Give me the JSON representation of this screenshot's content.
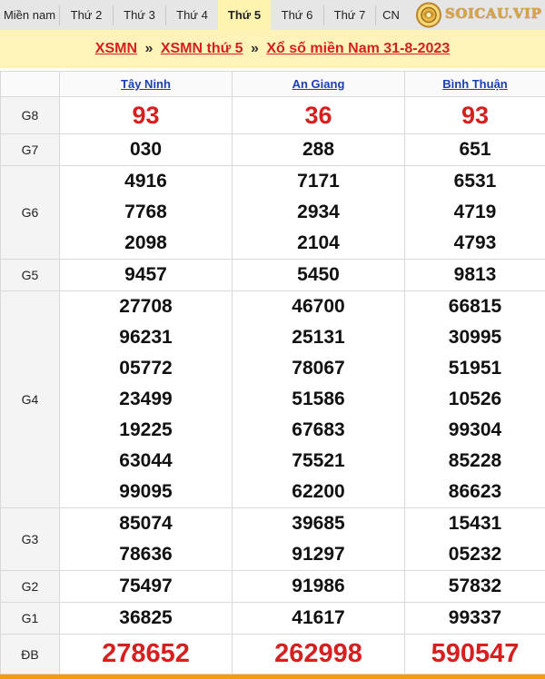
{
  "nav": {
    "tabs": [
      {
        "label": "Miền nam",
        "active": false
      },
      {
        "label": "Thứ 2",
        "active": false
      },
      {
        "label": "Thứ 3",
        "active": false
      },
      {
        "label": "Thứ 4",
        "active": false
      },
      {
        "label": "Thứ 5",
        "active": true
      },
      {
        "label": "Thứ 6",
        "active": false
      },
      {
        "label": "Thứ 7",
        "active": false
      },
      {
        "label": "CN",
        "active": false
      }
    ],
    "logo_text": "SOICAU.VIP"
  },
  "breadcrumb": {
    "items": [
      "XSMN",
      "XSMN thứ 5",
      "Xổ số miền Nam 31-8-2023"
    ],
    "separator": "»"
  },
  "table": {
    "provinces": [
      "Tây Ninh",
      "An Giang",
      "Bình Thuận"
    ],
    "rows": [
      {
        "label": "G8",
        "values": [
          [
            "93"
          ],
          [
            "36"
          ],
          [
            "93"
          ]
        ]
      },
      {
        "label": "G7",
        "values": [
          [
            "030"
          ],
          [
            "288"
          ],
          [
            "651"
          ]
        ]
      },
      {
        "label": "G6",
        "values": [
          [
            "4916",
            "7768",
            "2098"
          ],
          [
            "7171",
            "2934",
            "2104"
          ],
          [
            "6531",
            "4719",
            "4793"
          ]
        ]
      },
      {
        "label": "G5",
        "values": [
          [
            "9457"
          ],
          [
            "5450"
          ],
          [
            "9813"
          ]
        ]
      },
      {
        "label": "G4",
        "values": [
          [
            "27708",
            "96231",
            "05772",
            "23499",
            "19225",
            "63044",
            "99095"
          ],
          [
            "46700",
            "25131",
            "78067",
            "51586",
            "67683",
            "75521",
            "62200"
          ],
          [
            "66815",
            "30995",
            "51951",
            "10526",
            "99304",
            "85228",
            "86623"
          ]
        ]
      },
      {
        "label": "G3",
        "values": [
          [
            "85074",
            "78636"
          ],
          [
            "39685",
            "91297"
          ],
          [
            "15431",
            "05232"
          ]
        ]
      },
      {
        "label": "G2",
        "values": [
          [
            "75497"
          ],
          [
            "91986"
          ],
          [
            "57832"
          ]
        ]
      },
      {
        "label": "G1",
        "values": [
          [
            "36825"
          ],
          [
            "41617"
          ],
          [
            "99337"
          ]
        ]
      },
      {
        "label": "ĐB",
        "values": [
          [
            "278652"
          ],
          [
            "262998"
          ],
          [
            "590547"
          ]
        ]
      }
    ]
  },
  "colors": {
    "accent_red": "#d61f1f",
    "link_blue": "#1a3fb0",
    "highlight_yellow": "#fff3b8",
    "bottom_bar": "#f39c12"
  }
}
